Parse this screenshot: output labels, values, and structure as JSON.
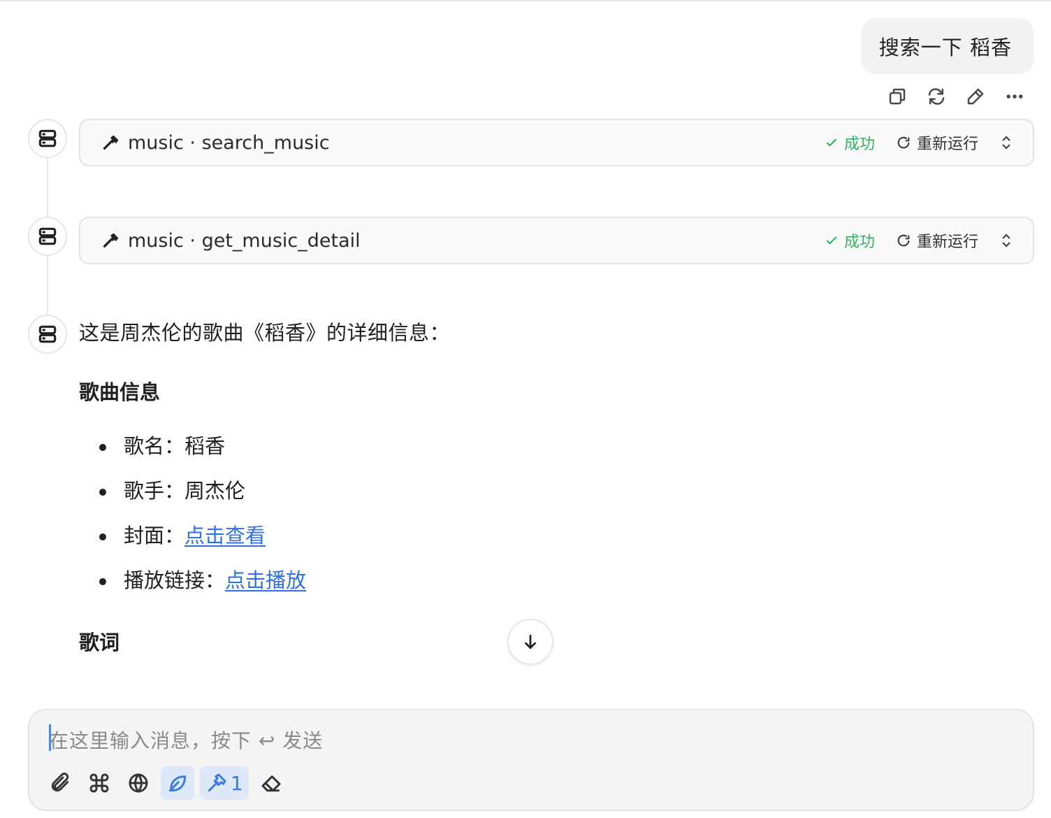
{
  "user_message": "搜索一下 稻香",
  "message_actions": [
    "copy-icon",
    "regenerate-icon",
    "edit-icon",
    "more-icon"
  ],
  "tool_calls": [
    {
      "name": "music · search_music",
      "status": "成功",
      "rerun_label": "重新运行"
    },
    {
      "name": "music · get_music_detail",
      "status": "成功",
      "rerun_label": "重新运行"
    }
  ],
  "answer": {
    "intro": "这是周杰伦的歌曲《稻香》的详细信息：",
    "section_title": "歌曲信息",
    "items": [
      {
        "label": "歌名：",
        "value": "稻香"
      },
      {
        "label": "歌手：",
        "value": "周杰伦"
      },
      {
        "label": "封面：",
        "link": "点击查看"
      },
      {
        "label": "播放链接：",
        "link": "点击播放"
      }
    ],
    "lyrics_title": "歌词"
  },
  "composer": {
    "placeholder": "在这里输入消息，按下 ↩ 发送",
    "tools_count": "1"
  },
  "colors": {
    "success": "#2db55d",
    "link": "#2f6fe0",
    "active_tool": "#3a7be0"
  }
}
